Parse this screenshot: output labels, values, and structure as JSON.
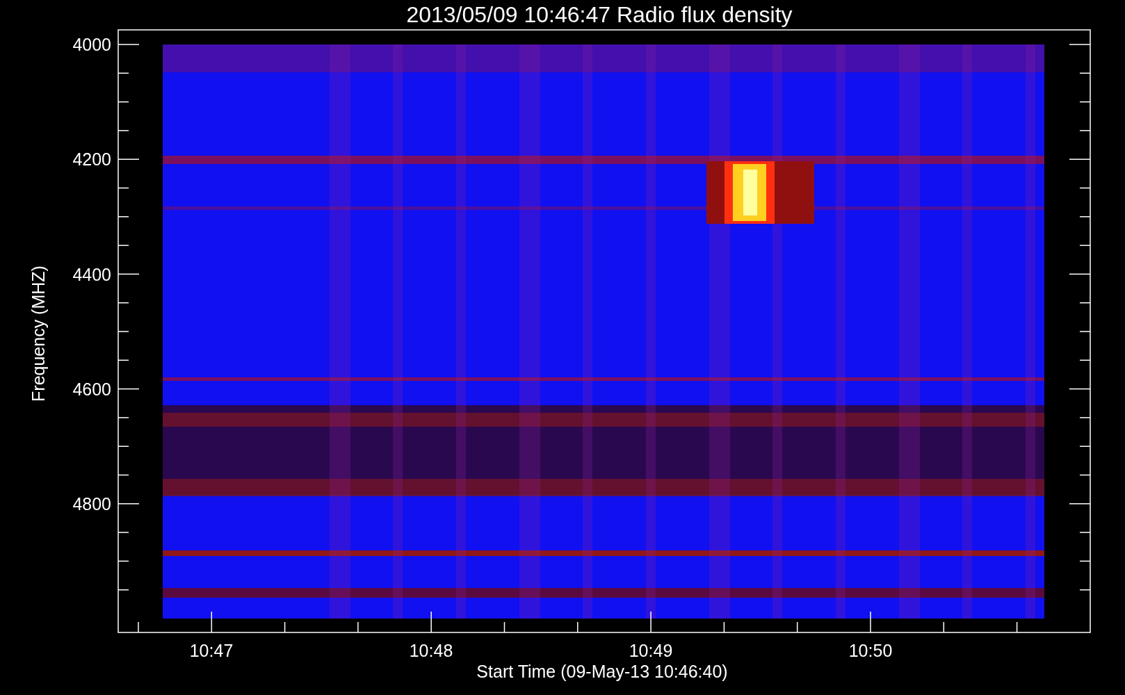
{
  "title": "2013/05/09 10:46:47 Radio flux density",
  "y_axis": {
    "label": "Frequency (MHZ)",
    "ticks": [
      "4000",
      "4200",
      "4400",
      "4600",
      "4800"
    ]
  },
  "x_axis": {
    "label": "Start Time (09-May-13 10:46:40)",
    "ticks": [
      "10:47",
      "10:48",
      "10:49",
      "10:50"
    ]
  }
}
